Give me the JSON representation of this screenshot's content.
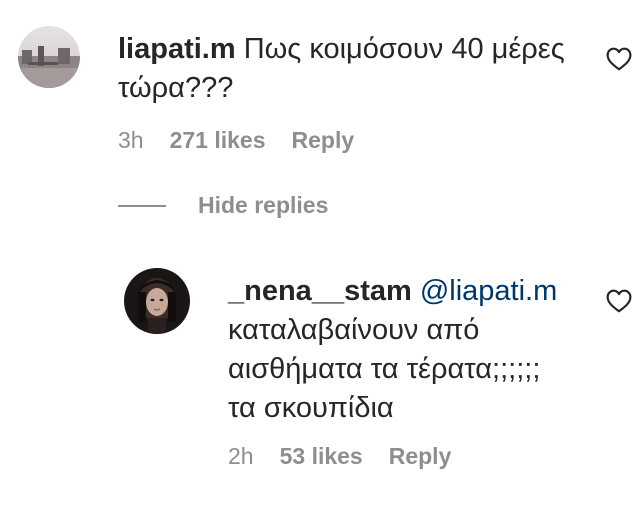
{
  "comment": {
    "username": "liapati.m",
    "text_line1": "Πως κοιμόσουν 40 μέρες",
    "text_line2": "τώρα???",
    "time": "3h",
    "likes": "271 likes",
    "reply_label": "Reply",
    "like_icon": "heart-outline-icon"
  },
  "hide_replies_label": "Hide replies",
  "reply": {
    "username": "_nena__stam",
    "mention": "@liapati.m",
    "text_line1": "καταλαβαίνουν από",
    "text_line2": "αισθήματα τα τέρατα;;;;;;",
    "text_line3": "τα σκουπίδια",
    "time": "2h",
    "likes": "53 likes",
    "reply_label": "Reply",
    "like_icon": "heart-outline-icon"
  }
}
